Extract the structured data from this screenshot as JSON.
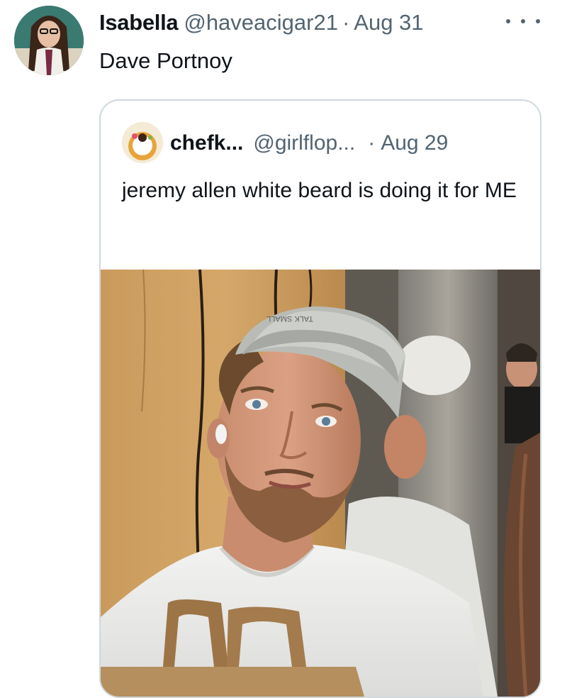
{
  "tweet": {
    "author_name": "Isabella",
    "author_handle": "@haveacigar21",
    "separator": "·",
    "date": "Aug 31",
    "text": "Dave Portnoy",
    "more_icon": "more-horizontal-icon"
  },
  "quoted_tweet": {
    "author_name": "chefk...",
    "author_handle": "@girlflop...",
    "separator": "·",
    "date": "Aug 29",
    "text": "jeremy allen white beard is doing it for ME",
    "media": {
      "cap_text": "TALK SMALL"
    }
  },
  "colors": {
    "text_primary": "#0f1419",
    "text_secondary": "#536471",
    "border": "#cfd9de"
  }
}
